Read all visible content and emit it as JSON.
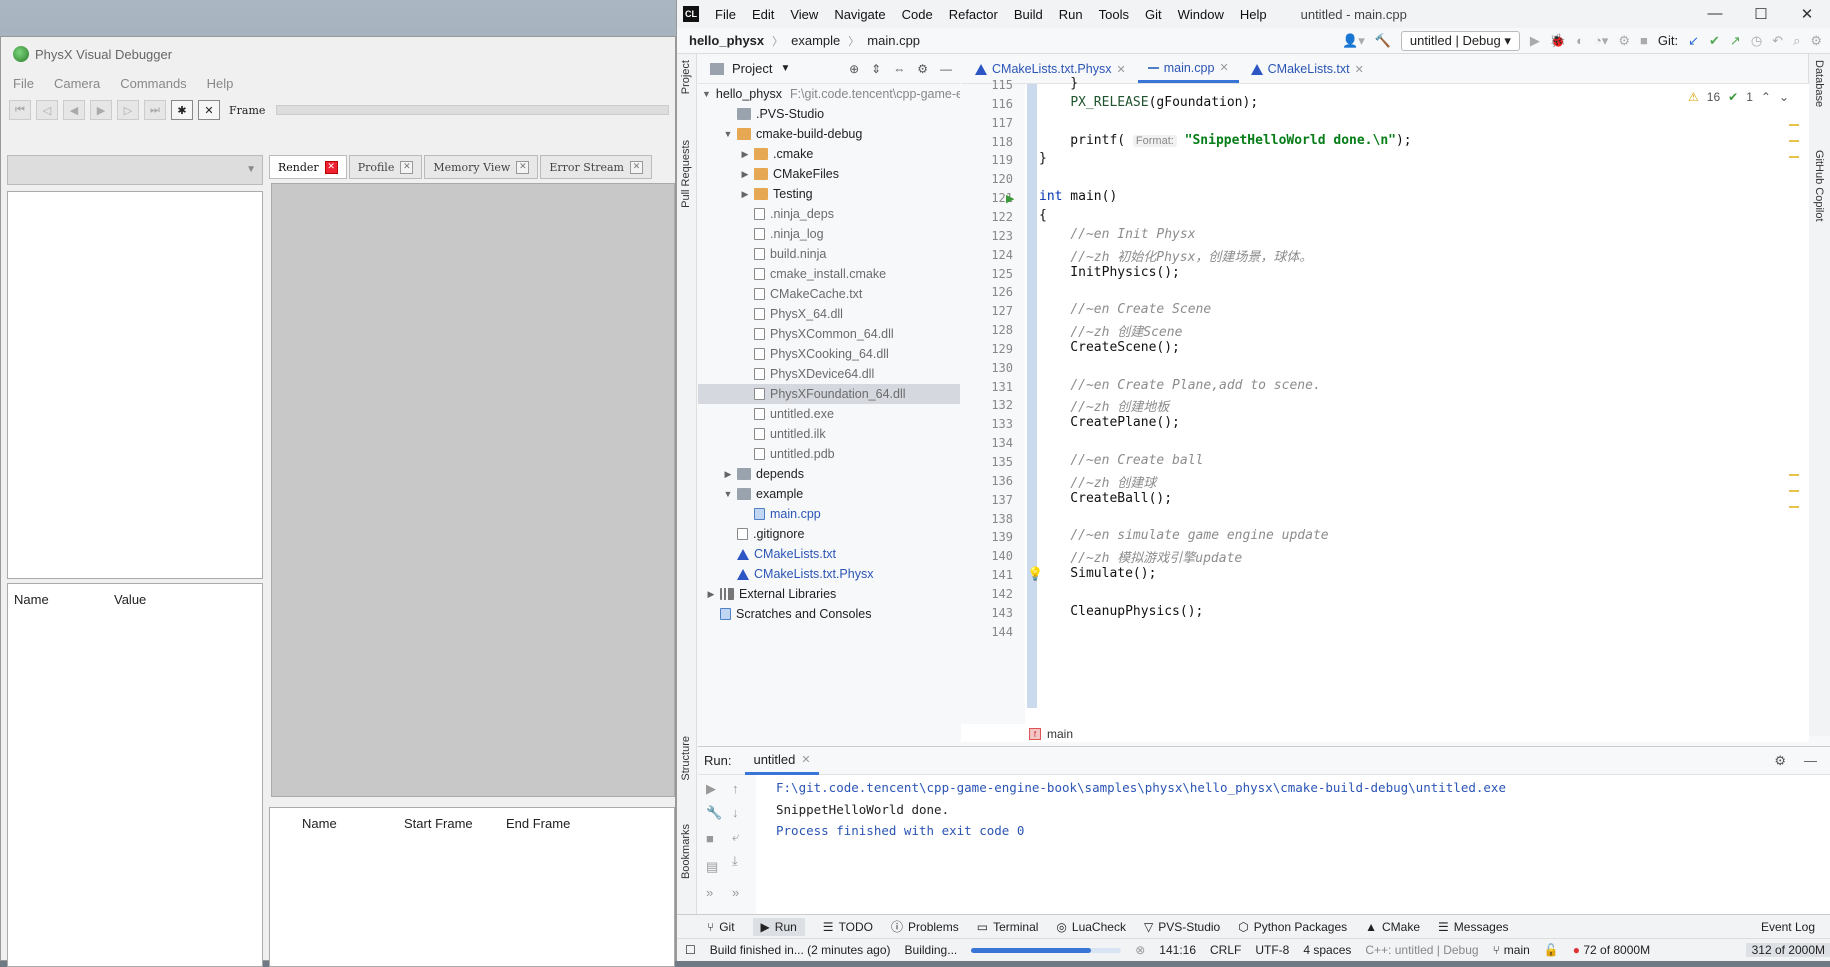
{
  "pvd": {
    "title": "PhysX Visual Debugger",
    "menu": [
      "File",
      "Camera",
      "Commands",
      "Help"
    ],
    "frame_label": "Frame",
    "tabs": [
      {
        "label": "Render",
        "active": true
      },
      {
        "label": "Profile",
        "active": false
      },
      {
        "label": "Memory View",
        "active": false
      },
      {
        "label": "Error Stream",
        "active": false
      }
    ],
    "props_headers": [
      "Name",
      "Value"
    ],
    "bottom_headers": [
      "Name",
      "Start Frame",
      "End Frame"
    ]
  },
  "ide": {
    "menu": [
      "File",
      "Edit",
      "View",
      "Navigate",
      "Code",
      "Refactor",
      "Build",
      "Run",
      "Tools",
      "Git",
      "Window",
      "Help"
    ],
    "window_title": "untitled - main.cpp",
    "breadcrumb": [
      "hello_physx",
      "example",
      "main.cpp"
    ],
    "run_config": "untitled | Debug",
    "git_label": "Git:",
    "left_strip": [
      "Project",
      "Pull Requests",
      "Structure",
      "Bookmarks"
    ],
    "right_strip": [
      "Database",
      "GitHub Copilot"
    ],
    "project_title": "Project",
    "tree": [
      {
        "label": "hello_physx",
        "extra": "F:\\git.code.tencent\\cpp-game-engine-book",
        "depth": 0,
        "arrow": "v",
        "icon": "folder",
        "bold": true
      },
      {
        "label": ".PVS-Studio",
        "depth": 1,
        "arrow": "",
        "icon": "folder"
      },
      {
        "label": "cmake-build-debug",
        "depth": 1,
        "arrow": "v",
        "icon": "ofolder"
      },
      {
        "label": ".cmake",
        "depth": 2,
        "arrow": ">",
        "icon": "ofolder"
      },
      {
        "label": "CMakeFiles",
        "depth": 2,
        "arrow": ">",
        "icon": "ofolder"
      },
      {
        "label": "Testing",
        "depth": 2,
        "arrow": ">",
        "icon": "ofolder"
      },
      {
        "label": ".ninja_deps",
        "depth": 2,
        "arrow": "",
        "icon": "file",
        "dim": true
      },
      {
        "label": ".ninja_log",
        "depth": 2,
        "arrow": "",
        "icon": "file",
        "dim": true
      },
      {
        "label": "build.ninja",
        "depth": 2,
        "arrow": "",
        "icon": "file",
        "dim": true
      },
      {
        "label": "cmake_install.cmake",
        "depth": 2,
        "arrow": "",
        "icon": "file",
        "dim": true
      },
      {
        "label": "CMakeCache.txt",
        "depth": 2,
        "arrow": "",
        "icon": "file",
        "dim": true
      },
      {
        "label": "PhysX_64.dll",
        "depth": 2,
        "arrow": "",
        "icon": "file",
        "dim": true
      },
      {
        "label": "PhysXCommon_64.dll",
        "depth": 2,
        "arrow": "",
        "icon": "file",
        "dim": true
      },
      {
        "label": "PhysXCooking_64.dll",
        "depth": 2,
        "arrow": "",
        "icon": "file",
        "dim": true
      },
      {
        "label": "PhysXDevice64.dll",
        "depth": 2,
        "arrow": "",
        "icon": "file",
        "dim": true
      },
      {
        "label": "PhysXFoundation_64.dll",
        "depth": 2,
        "arrow": "",
        "icon": "file",
        "dim": true,
        "selected": true
      },
      {
        "label": "untitled.exe",
        "depth": 2,
        "arrow": "",
        "icon": "file",
        "dim": true
      },
      {
        "label": "untitled.ilk",
        "depth": 2,
        "arrow": "",
        "icon": "file",
        "dim": true
      },
      {
        "label": "untitled.pdb",
        "depth": 2,
        "arrow": "",
        "icon": "file",
        "dim": true
      },
      {
        "label": "depends",
        "depth": 1,
        "arrow": ">",
        "icon": "folder"
      },
      {
        "label": "example",
        "depth": 1,
        "arrow": "v",
        "icon": "folder"
      },
      {
        "label": "main.cpp",
        "depth": 2,
        "arrow": "",
        "icon": "cpp",
        "blue": true
      },
      {
        "label": ".gitignore",
        "depth": 1,
        "arrow": "",
        "icon": "file"
      },
      {
        "label": "CMakeLists.txt",
        "depth": 1,
        "arrow": "",
        "icon": "cmake",
        "blue": true
      },
      {
        "label": "CMakeLists.txt.Physx",
        "depth": 1,
        "arrow": "",
        "icon": "cmake",
        "blue": true
      },
      {
        "label": "External Libraries",
        "depth": 0,
        "arrow": ">",
        "icon": "lib"
      },
      {
        "label": "Scratches and Consoles",
        "depth": 0,
        "arrow": "",
        "icon": "cpp"
      }
    ],
    "editor_tabs": [
      {
        "label": "CMakeLists.txt.Physx",
        "active": false
      },
      {
        "label": "main.cpp",
        "active": true
      },
      {
        "label": "CMakeLists.txt",
        "active": false
      }
    ],
    "inspections": {
      "warnings": "16",
      "ok": "1"
    },
    "code_lines": [
      {
        "n": "115",
        "html": "    }"
      },
      {
        "n": "116",
        "html": "    <span class='mac'>PX_RELEASE</span>(gFoundation);"
      },
      {
        "n": "117",
        "html": ""
      },
      {
        "n": "118",
        "html": "    printf( <span class='hint'>Format:</span> <span class='st'>\"SnippetHelloWorld done.\\n\"</span>);"
      },
      {
        "n": "119",
        "html": "}"
      },
      {
        "n": "120",
        "html": ""
      },
      {
        "n": "121",
        "html": "<span class='kw'>int</span> main()",
        "run": true
      },
      {
        "n": "122",
        "html": "{"
      },
      {
        "n": "123",
        "html": "    <span class='cm'>//~en Init Physx</span>"
      },
      {
        "n": "124",
        "html": "    <span class='cm'>//~zh 初始化Physx，创建场景，球体。</span>"
      },
      {
        "n": "125",
        "html": "    InitPhysics();"
      },
      {
        "n": "126",
        "html": ""
      },
      {
        "n": "127",
        "html": "    <span class='cm'>//~en Create Scene</span>"
      },
      {
        "n": "128",
        "html": "    <span class='cm'>//~zh 创建Scene</span>"
      },
      {
        "n": "129",
        "html": "    CreateScene();"
      },
      {
        "n": "130",
        "html": ""
      },
      {
        "n": "131",
        "html": "    <span class='cm'>//~en Create Plane,add to scene.</span>"
      },
      {
        "n": "132",
        "html": "    <span class='cm'>//~zh 创建地板</span>"
      },
      {
        "n": "133",
        "html": "    CreatePlane();"
      },
      {
        "n": "134",
        "html": ""
      },
      {
        "n": "135",
        "html": "    <span class='cm'>//~en Create ball</span>"
      },
      {
        "n": "136",
        "html": "    <span class='cm'>//~zh 创建球</span>"
      },
      {
        "n": "137",
        "html": "    CreateBall();"
      },
      {
        "n": "138",
        "html": ""
      },
      {
        "n": "139",
        "html": "    <span class='cm'>//~en simulate game engine update</span>"
      },
      {
        "n": "140",
        "html": "    <span class='cm'>//~zh 模拟游戏引擎update</span>"
      },
      {
        "n": "141",
        "html": "    Simulate();",
        "bulb": true
      },
      {
        "n": "142",
        "html": ""
      },
      {
        "n": "143",
        "html": "    CleanupPhysics();"
      },
      {
        "n": "144",
        "html": ""
      }
    ],
    "code_breadcrumb": "main",
    "run": {
      "label": "Run:",
      "tab": "untitled",
      "output": [
        {
          "text": "F:\\git.code.tencent\\cpp-game-engine-book\\samples\\physx\\hello_physx\\cmake-build-debug\\untitled.exe",
          "cls": "p"
        },
        {
          "text": "SnippetHelloWorld done.",
          "cls": ""
        },
        {
          "text": "",
          "cls": ""
        },
        {
          "text": "Process finished with exit code 0",
          "cls": "p"
        }
      ]
    },
    "tool_windows": [
      "Git",
      "Run",
      "TODO",
      "Problems",
      "Terminal",
      "LuaCheck",
      "PVS-Studio",
      "Python Packages",
      "CMake",
      "Messages"
    ],
    "event_log": "Event Log",
    "status": {
      "build": "Build finished in... (2 minutes ago)",
      "building": "Building...",
      "progress": 0.8,
      "position": "141:16",
      "line_sep": "CRLF",
      "encoding": "UTF-8",
      "indent": "4 spaces",
      "context": "C++: untitled | Debug",
      "branch": "main",
      "mem1": "72 of 8000M",
      "mem2": "312 of 2000M"
    }
  }
}
